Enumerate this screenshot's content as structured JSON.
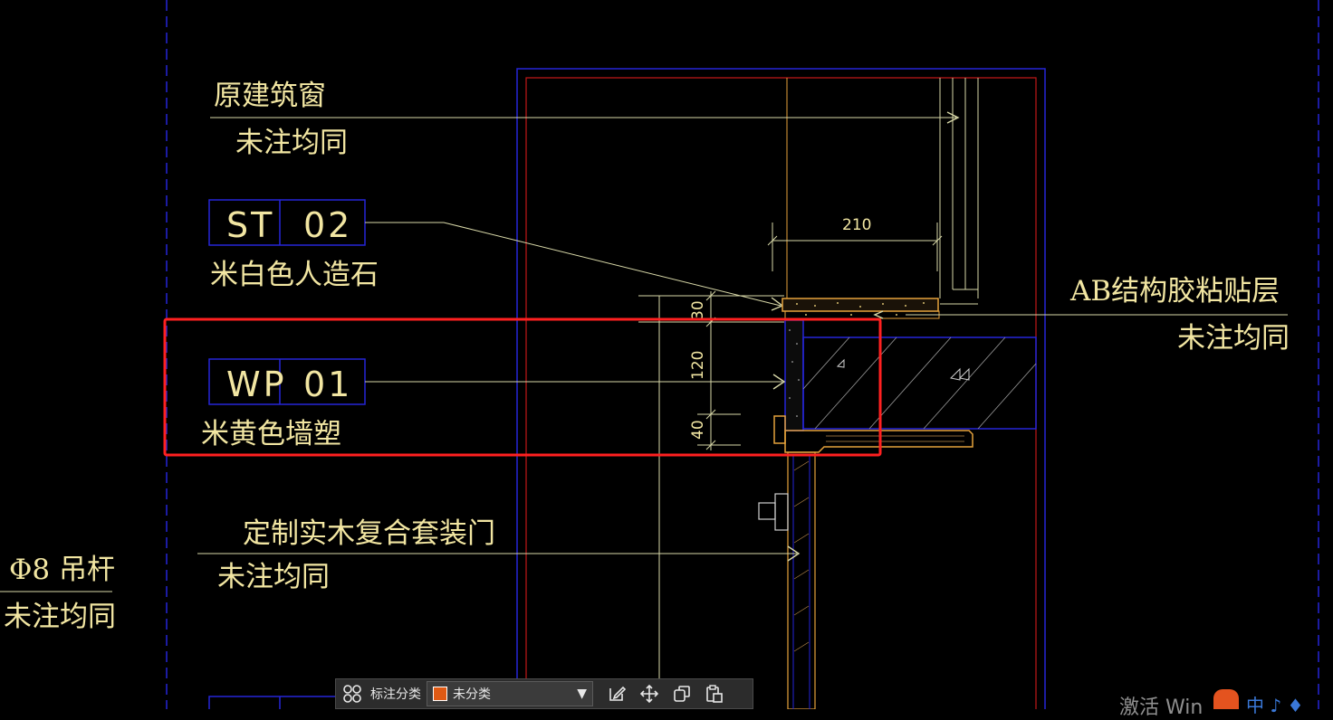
{
  "drawing": {
    "annotations": {
      "window_title": "原建筑窗",
      "window_sub": "未注均同",
      "st_code_a": "ST",
      "st_code_b": "02",
      "st_desc": "米白色人造石",
      "ab_title": "AB结构胶粘贴层",
      "ab_sub": "未注均同",
      "wp_code_a": "WP",
      "wp_code_b": "01",
      "wp_desc": "米黄色墙塑",
      "door_title": "定制实木复合套装门",
      "door_sub": "未注均同",
      "rod_title": "Φ8 吊杆",
      "rod_sub": "未注均同"
    },
    "dimensions": {
      "width_210": "210",
      "dim_30": "30",
      "dim_120": "120",
      "dim_40": "40"
    },
    "colors": {
      "background": "#000000",
      "label_text": "#f2e6a2",
      "leader": "#d8d8a8",
      "frame_blue": "#2525d8",
      "frame_red": "#c01818",
      "orange": "#e6a23c",
      "highlight": "#ff2020"
    }
  },
  "toolbar": {
    "grid_icon": "grid-icon",
    "category_label": "标注分类",
    "category_value": "未分类",
    "category_color": "#e05a14",
    "edit_icon": "edit-icon",
    "move_icon": "move-icon",
    "copy_icon": "copy-icon",
    "paste_icon": "paste-icon"
  },
  "system": {
    "watermark": "激活 Win"
  }
}
